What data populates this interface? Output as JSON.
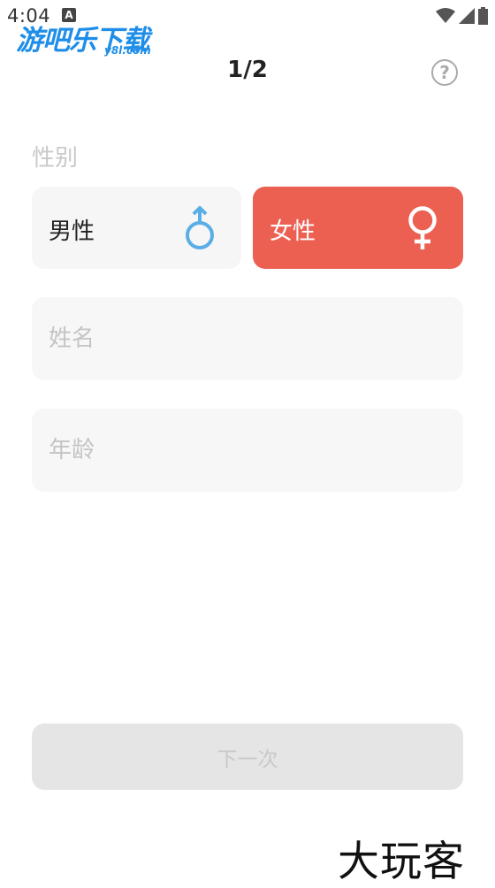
{
  "status_bar": {
    "time": "4:04",
    "notification_icon": "A"
  },
  "watermark": {
    "main": "游吧乐下载",
    "sub": "y8l.com"
  },
  "header": {
    "step": "1/2",
    "help_icon": "?"
  },
  "gender": {
    "label": "性别",
    "male": {
      "label": "男性",
      "icon": "male-symbol-icon",
      "color": "#5aaee6",
      "selected": false
    },
    "female": {
      "label": "女性",
      "icon": "female-symbol-icon",
      "color": "#ec6052",
      "selected": true
    }
  },
  "form": {
    "name_placeholder": "姓名",
    "age_placeholder": "年龄"
  },
  "next_button": {
    "label": "下一次",
    "enabled": false
  },
  "brand_mark": "大玩客"
}
